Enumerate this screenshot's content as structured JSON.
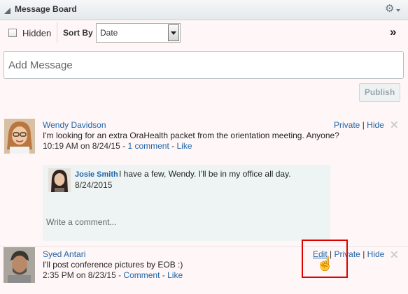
{
  "header": {
    "title": "Message Board"
  },
  "toolbar": {
    "hidden_label": "Hidden",
    "sort_label": "Sort By",
    "sort_value": "Date",
    "more_label": "»"
  },
  "composer": {
    "placeholder": "Add Message",
    "publish_label": "Publish"
  },
  "messages": [
    {
      "author": "Wendy Davidson",
      "text": "I'm looking for an extra OraHealth packet from the orientation meeting. Anyone?",
      "time": "10:19 AM on 8/24/15 -",
      "comment_link": "1 comment",
      "like_link": "Like",
      "actions": {
        "private": "Private",
        "hide": "Hide"
      },
      "replies": [
        {
          "author": "Josie Smith",
          "text": "I have a few, Wendy. I'll be in my office all day.",
          "date": "8/24/2015"
        }
      ],
      "comment_placeholder": "Write a comment..."
    },
    {
      "author": "Syed Antari",
      "text": "I'll post conference pictures by EOB :)",
      "time": "2:35 PM on 8/23/15 -",
      "comment_link": "Comment",
      "like_link": "Like",
      "actions": {
        "edit": "Edit",
        "private": "Private",
        "hide": "Hide"
      }
    }
  ],
  "separators": {
    "pipe": "|",
    "dash": "-"
  },
  "icons": {
    "collapse": "collapse-triangle-icon",
    "settings": "gear-icon",
    "more": "double-chevron-icon",
    "close": "close-icon",
    "cursor": "hand-pointer-icon"
  },
  "colors": {
    "link": "#2266a8",
    "background": "#fff7f7",
    "highlight": "#e00000"
  }
}
